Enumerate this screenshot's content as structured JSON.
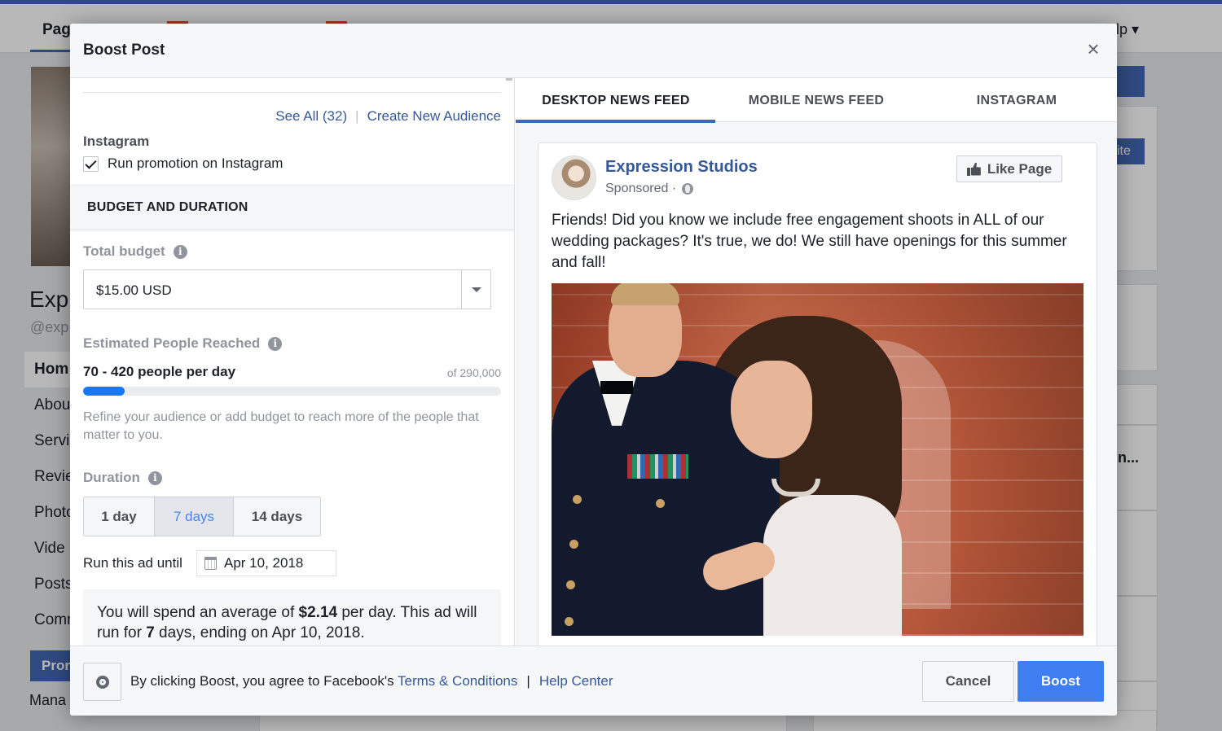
{
  "background": {
    "tab_pages": "Pag",
    "help": "lp ▾",
    "page_name": "Exp",
    "page_handle": "@exp",
    "side_items": [
      "Hom",
      "Abou",
      "Servi",
      "Revie",
      "Photo",
      "Vide",
      "Posts",
      "Comr"
    ],
    "promote": "Pron",
    "manage": "Mana",
    "right_snippets": [
      "ite",
      "n..."
    ]
  },
  "modal": {
    "title": "Boost Post",
    "close_glyph": "×",
    "audience": {
      "see_all": "See All (32)",
      "create_new": "Create New Audience",
      "instagram_heading": "Instagram",
      "instagram_checkbox_label": "Run promotion on Instagram",
      "instagram_checked": true
    },
    "budget_section": {
      "title": "BUDGET AND DURATION",
      "total_budget_label": "Total budget",
      "total_budget_value": "$15.00 USD",
      "reached_label": "Estimated People Reached",
      "reached_value": "70 - 420 people per day",
      "reached_of": "of 290,000",
      "reached_fill_fraction": 0.1,
      "refine_text": "Refine your audience or add budget to reach more of the people that matter to you.",
      "duration_label": "Duration",
      "duration_options": [
        "1 day",
        "7 days",
        "14 days"
      ],
      "duration_selected": "7 days",
      "run_until_label": "Run this ad until",
      "run_until_date": "Apr 10, 2018",
      "spend_summary": {
        "p1": "You will spend an average of ",
        "amount": "$2.14",
        "p2": " per day. This ad will run for ",
        "days": "7",
        "p3": " days, ending on Apr 10, 2018."
      }
    },
    "preview": {
      "tabs": [
        "DESKTOP NEWS FEED",
        "MOBILE NEWS FEED",
        "INSTAGRAM"
      ],
      "active_tab": "DESKTOP NEWS FEED",
      "page_name": "Expression Studios",
      "sponsored": "Sponsored ·",
      "like_page": "Like Page",
      "post_text": "Friends! Did you know we include free engagement shoots in ALL of our wedding packages? It's true, we do! We still have openings for this summer and fall!"
    },
    "footer": {
      "agree_prefix": "By clicking Boost, you agree to Facebook's ",
      "terms_link": "Terms & Conditions",
      "separator": "|",
      "help_link": "Help Center",
      "cancel": "Cancel",
      "boost": "Boost"
    },
    "colors": {
      "link": "#365899",
      "accent_blue": "#4267b2",
      "boost_button": "#3f7ef0",
      "reach_fill": "#1877f2"
    }
  }
}
